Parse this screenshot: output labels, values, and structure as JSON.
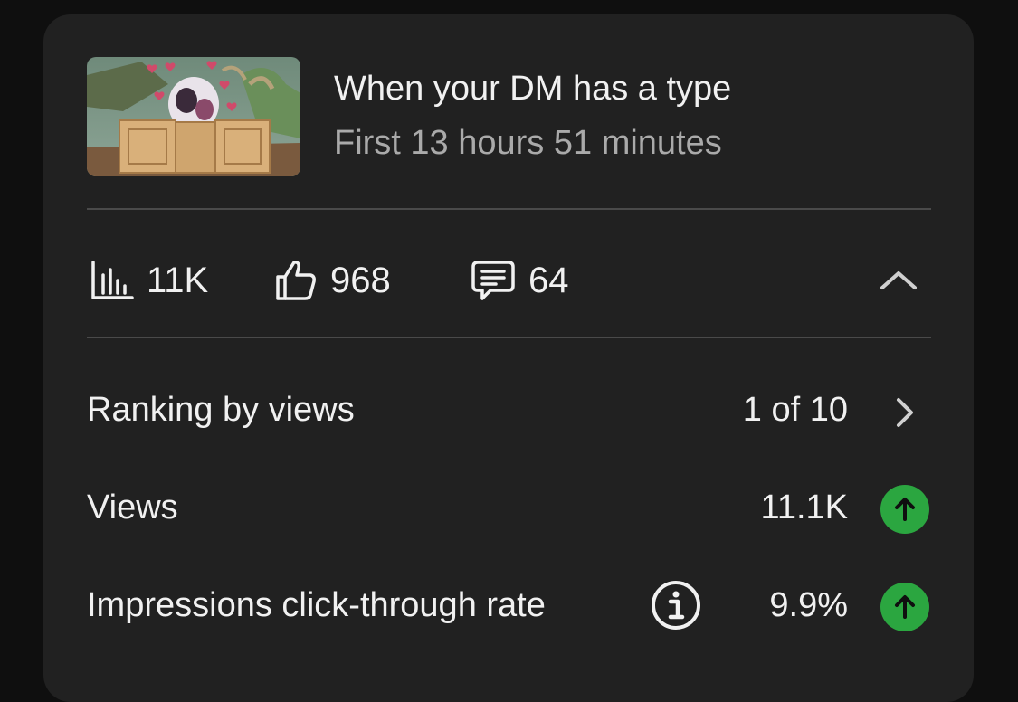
{
  "video": {
    "title": "When your DM has a type",
    "period": "First 13 hours 51 minutes"
  },
  "stats": {
    "views": "11K",
    "likes": "968",
    "comments": "64"
  },
  "metrics": [
    {
      "label": "Ranking by views",
      "value": "1 of 10"
    },
    {
      "label": "Views",
      "value": "11.1K",
      "trend": "up"
    },
    {
      "label": "Impressions click-through rate",
      "value": "9.9%",
      "trend": "up"
    }
  ],
  "colors": {
    "card_bg": "#212121",
    "page_bg": "#0f0f0f",
    "trend_up": "#2ba640",
    "secondary_text": "#aaaaaa"
  },
  "icons": [
    "bar-chart-icon",
    "thumbs-up-icon",
    "comment-icon",
    "chevron-up-icon",
    "chevron-right-icon",
    "info-icon",
    "arrow-up-icon"
  ]
}
